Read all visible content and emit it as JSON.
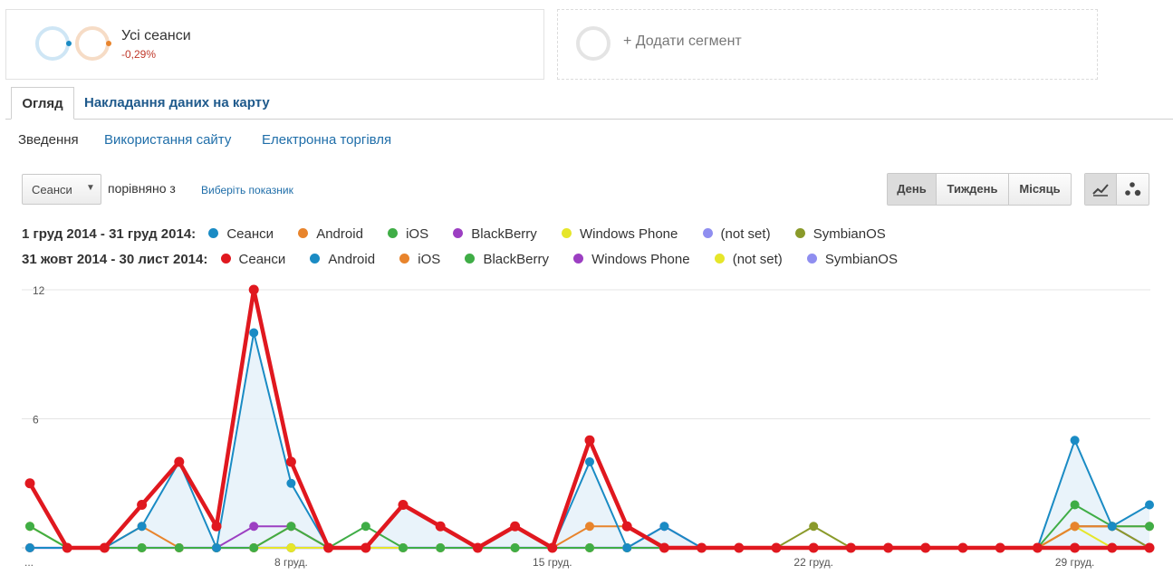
{
  "segments": {
    "all_sessions": {
      "name": "Усі сеанси",
      "change": "-0,29%"
    },
    "add_segment": {
      "label": "+ Додати сегмент"
    }
  },
  "tabs": [
    {
      "label": "Огляд",
      "active": true
    },
    {
      "label": "Накладання даних на карту",
      "active": false
    }
  ],
  "subnav": [
    {
      "label": "Зведення",
      "active": true
    },
    {
      "label": "Використання сайту",
      "active": false
    },
    {
      "label": "Електронна торгівля",
      "active": false
    }
  ],
  "controls": {
    "metric": "Сеанси",
    "compare_text": "порівняно з",
    "choose_metric": "Виберіть показник",
    "periods": [
      {
        "label": "День",
        "active": true
      },
      {
        "label": "Тиждень",
        "active": false
      },
      {
        "label": "Місяць",
        "active": false
      }
    ],
    "views": [
      {
        "icon": "line-chart-icon",
        "active": true
      },
      {
        "icon": "motion-chart-icon",
        "active": false
      }
    ]
  },
  "legend": {
    "current_range": "1 груд 2014 - 31 груд 2014:",
    "previous_range": "31 жовт 2014 - 30 лист 2014:",
    "current": [
      {
        "name": "Сеанси",
        "color": "#1a8bc4"
      },
      {
        "name": "Android",
        "color": "#e8842c"
      },
      {
        "name": "iOS",
        "color": "#3fad46"
      },
      {
        "name": "BlackBerry",
        "color": "#9c3fc2"
      },
      {
        "name": "Windows Phone",
        "color": "#e6e62a"
      },
      {
        "name": "(not set)",
        "color": "#8f8ef0"
      },
      {
        "name": "SymbianOS",
        "color": "#8a9a2a"
      }
    ],
    "previous": [
      {
        "name": "Сеанси",
        "color": "#e0181f"
      },
      {
        "name": "Android",
        "color": "#1a8bc4"
      },
      {
        "name": "iOS",
        "color": "#e8842c"
      },
      {
        "name": "BlackBerry",
        "color": "#3fad46"
      },
      {
        "name": "Windows Phone",
        "color": "#9c3fc2"
      },
      {
        "name": "(not set)",
        "color": "#e6e62a"
      },
      {
        "name": "SymbianOS",
        "color": "#8f8ef0"
      }
    ]
  },
  "chart_data": {
    "type": "line",
    "y_ticks": [
      "12",
      "6"
    ],
    "ylim": [
      0,
      12
    ],
    "x_labels": [
      {
        "index": 0,
        "text": "..."
      },
      {
        "index": 7,
        "text": "8 груд."
      },
      {
        "index": 14,
        "text": "15 груд."
      },
      {
        "index": 21,
        "text": "22 груд."
      },
      {
        "index": 28,
        "text": "29 груд."
      }
    ],
    "grid": true,
    "series": [
      {
        "color": "#8f8ef0",
        "width": 2.5,
        "values": [
          0,
          0,
          0,
          0,
          0,
          0,
          0,
          0,
          0,
          0,
          0,
          0,
          0,
          0,
          0,
          0,
          0,
          0,
          0,
          0,
          0,
          0,
          0,
          0,
          0,
          0,
          0,
          0,
          0,
          0,
          0
        ]
      },
      {
        "color": "#9c3fc2",
        "width": 2,
        "values": [
          0,
          0,
          0,
          0,
          0,
          0,
          1,
          1,
          0,
          0,
          0,
          0,
          0,
          0,
          0,
          0,
          0,
          1,
          0,
          0,
          0,
          0,
          0,
          0,
          0,
          0,
          0,
          0,
          1,
          1,
          0
        ]
      },
      {
        "color": "#8a9a2a",
        "width": 2,
        "values": [
          1,
          0,
          0,
          0,
          0,
          0,
          0,
          0,
          0,
          0,
          0,
          0,
          0,
          0,
          0,
          0,
          0,
          0,
          0,
          0,
          0,
          1,
          0,
          0,
          0,
          0,
          0,
          0,
          1,
          1,
          0
        ]
      },
      {
        "color": "#e6e62a",
        "width": 2,
        "values": [
          1,
          0,
          0,
          0,
          0,
          0,
          0,
          0,
          0,
          0,
          0,
          0,
          0,
          0,
          0,
          0,
          0,
          0,
          0,
          0,
          0,
          0,
          0,
          0,
          0,
          0,
          0,
          0,
          1,
          0,
          0
        ]
      },
      {
        "color": "#e8842c",
        "width": 2,
        "values": [
          0,
          0,
          0,
          1,
          0,
          0,
          0,
          1,
          0,
          0,
          2,
          1,
          0,
          1,
          0,
          1,
          1,
          0,
          0,
          0,
          0,
          0,
          0,
          0,
          0,
          0,
          0,
          0,
          1,
          1,
          1
        ]
      },
      {
        "color": "#3fad46",
        "width": 2,
        "values": [
          1,
          0,
          0,
          0,
          0,
          0,
          0,
          1,
          0,
          1,
          0,
          0,
          0,
          0,
          0,
          0,
          0,
          0,
          0,
          0,
          0,
          0,
          0,
          0,
          0,
          0,
          0,
          0,
          2,
          1,
          1
        ]
      },
      {
        "color": "#1a8bc4",
        "width": 2,
        "values": [
          0,
          0,
          0,
          1,
          4,
          0,
          10,
          3,
          0,
          0,
          2,
          1,
          0,
          1,
          0,
          4,
          0,
          1,
          0,
          0,
          0,
          0,
          0,
          0,
          0,
          0,
          0,
          0,
          5,
          1,
          2
        ]
      },
      {
        "color": "#e0181f",
        "width": 4.5,
        "values": [
          3,
          0,
          0,
          2,
          4,
          1,
          12,
          4,
          0,
          0,
          2,
          1,
          0,
          1,
          0,
          5,
          1,
          0,
          0,
          0,
          0,
          0,
          0,
          0,
          0,
          0,
          0,
          0,
          0,
          0,
          0
        ]
      }
    ],
    "area_series_color": "#1a8bc4"
  }
}
